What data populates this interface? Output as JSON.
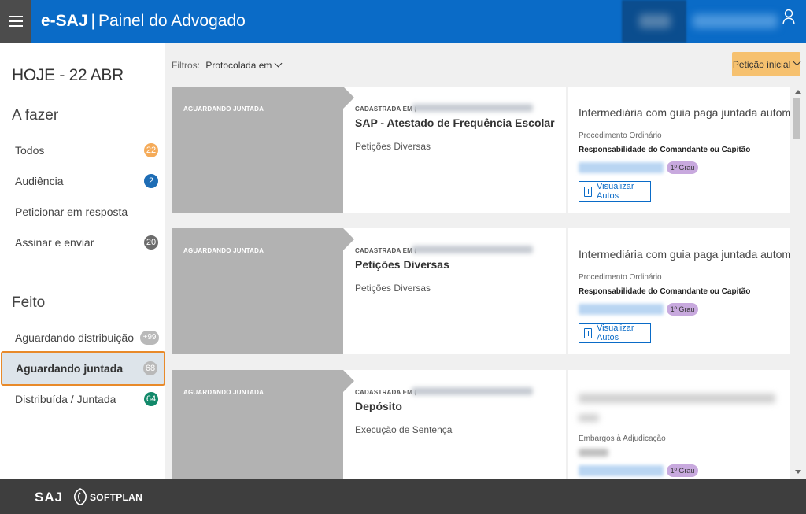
{
  "header": {
    "brand": "e-SAJ",
    "separator": "|",
    "subtitle": "Painel do Advogado"
  },
  "sidebar": {
    "today": "HOJE - 22 ABR",
    "todo_title": "A fazer",
    "todo_items": [
      {
        "label": "Todos",
        "count": "22",
        "color": "#f5ab59"
      },
      {
        "label": "Audiência",
        "count": "2",
        "color": "#1e6db5"
      },
      {
        "label": "Peticionar em resposta",
        "count": ""
      },
      {
        "label": "Assinar e enviar",
        "count": "20",
        "color": "#6c6c6c"
      }
    ],
    "done_title": "Feito",
    "done_items": [
      {
        "label": "Aguardando distribuição",
        "count": "+99",
        "color": "#b9b9b9"
      },
      {
        "label": "Aguardando juntada",
        "count": "68",
        "color": "#b9b9b9",
        "active": true
      },
      {
        "label": "Distribuída / Juntada",
        "count": "64",
        "color": "#12896a"
      }
    ]
  },
  "filters": {
    "label": "Filtros:",
    "value": "Protocolada em"
  },
  "new_petition_button": "Petição inicial",
  "cards": [
    {
      "status": "AGUARDANDO JUNTADA",
      "created_label": "CADASTRADA EM (",
      "title": "SAP - Atestado de Frequência Escolar",
      "classification": "Petições Diversas",
      "right_title": "Intermediária com guia paga juntada automática",
      "procedure": "Procedimento Ordinário",
      "subject": "Responsabilidade do Comandante ou Capitão",
      "degree": "1º Grau",
      "view_button": "Visualizar Autos"
    },
    {
      "status": "AGUARDANDO JUNTADA",
      "created_label": "CADASTRADA EM (",
      "title": "Petições Diversas",
      "classification": "Petições Diversas",
      "right_title": "Intermediária com guia paga juntada automática",
      "procedure": "Procedimento Ordinário",
      "subject": "Responsabilidade do Comandante ou Capitão",
      "degree": "1º Grau",
      "view_button": "Visualizar Autos"
    },
    {
      "status": "AGUARDANDO JUNTADA",
      "created_label": "CADASTRADA EM (",
      "title": "Depósito",
      "classification": "Execução de Sentença",
      "procedure": "Embargos à Adjudicação",
      "degree": "1º Grau"
    }
  ],
  "footer": {
    "saj": "SAJ",
    "softplan": "SOFTPLAN"
  },
  "colors": {
    "header": "#0a6bc7",
    "menu_button": "#4c4c4c",
    "active_outline": "#e88a2a",
    "primary_button": "#f6c16f",
    "status_block": "#b2b2b2",
    "footer": "#3e3e3e"
  },
  "icons": {
    "menu": "hamburger-icon",
    "user": "user-icon",
    "view": "document-icon",
    "filter": "chevron-down-icon"
  }
}
